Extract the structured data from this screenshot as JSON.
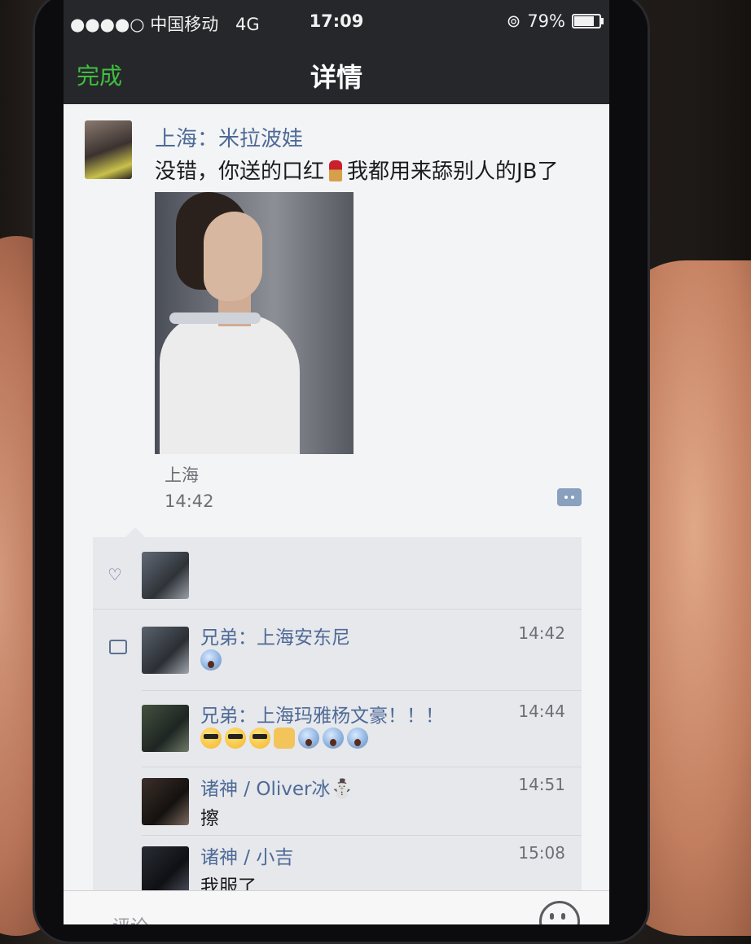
{
  "status_bar": {
    "carrier": "●●●●○ 中国移动",
    "network": "4G",
    "time": "17:09",
    "battery": "79%",
    "battery_level": 0.79
  },
  "nav": {
    "done_label": "完成",
    "title": "详情"
  },
  "post": {
    "author": "上海：米拉波娃",
    "text_before": "没错，你送的口红",
    "text_after": "我都用来舔别人的JB了",
    "location": "上海",
    "time": "14:42"
  },
  "comments": [
    {
      "name": "兄弟：上海安东尼",
      "time": "14:42",
      "emojis": [
        "scream"
      ]
    },
    {
      "name": "兄弟：上海玛雅杨文豪！！！",
      "time": "14:44",
      "emojis": [
        "cool",
        "cool",
        "cool",
        "peace",
        "scream",
        "scream",
        "scream"
      ]
    },
    {
      "name": "诸神 / Oliver冰⛄",
      "time": "14:51",
      "text": "擦"
    },
    {
      "name": "诸神 / 小吉",
      "time": "15:08",
      "text": "我服了"
    }
  ],
  "comment_bar": {
    "placeholder": "评论"
  },
  "colors": {
    "accent_green": "#3fbf3f",
    "name_blue": "#4e6a96",
    "navbar": "#26272b"
  }
}
